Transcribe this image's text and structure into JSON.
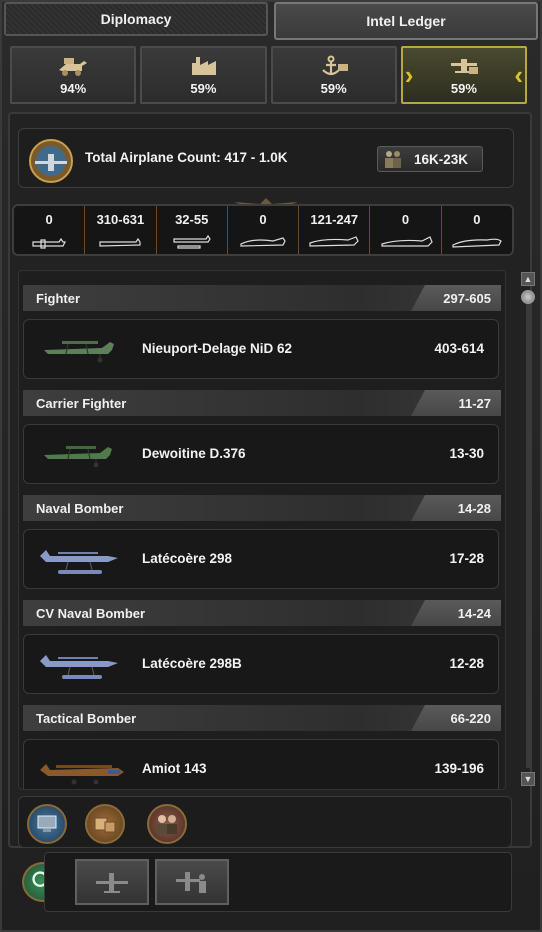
{
  "tabs": [
    {
      "label": "Diplomacy"
    },
    {
      "label": "Intel Ledger"
    }
  ],
  "categories": [
    {
      "icon": "army-icon",
      "value": "94%"
    },
    {
      "icon": "industry-icon",
      "value": "59%"
    },
    {
      "icon": "navy-icon",
      "value": "59%"
    },
    {
      "icon": "airforce-icon",
      "value": "59%"
    }
  ],
  "summary": {
    "total_label": "Total Airplane Count: 417 - 1.0K",
    "manpower": "16K-23K"
  },
  "aircraft_types": [
    {
      "icon": "cas-silhouette-icon",
      "value": "0"
    },
    {
      "icon": "transport-plane-icon",
      "value": "310-631"
    },
    {
      "icon": "naval-bomber-silhouette-icon",
      "value": "32-55"
    },
    {
      "icon": "heavy-fighter-silhouette-icon",
      "value": "0"
    },
    {
      "icon": "tactical-bomber-silhouette-icon",
      "value": "121-247"
    },
    {
      "icon": "strategic-bomber-silhouette-icon",
      "value": "0"
    },
    {
      "icon": "jet-silhouette-icon",
      "value": "0"
    }
  ],
  "sections": [
    {
      "name": "Fighter",
      "value": "297-605",
      "entry": {
        "name": "Nieuport-Delage NiD 62",
        "value": "403-614"
      }
    },
    {
      "name": "Carrier Fighter",
      "value": "11-27",
      "entry": {
        "name": "Dewoitine D.376",
        "value": "13-30"
      }
    },
    {
      "name": "Naval Bomber",
      "value": "14-28",
      "entry": {
        "name": "Latécoère 298",
        "value": "17-28"
      }
    },
    {
      "name": "CV Naval Bomber",
      "value": "14-24",
      "entry": {
        "name": "Latécoère 298B",
        "value": "12-28"
      }
    },
    {
      "name": "Tactical Bomber",
      "value": "66-220",
      "entry": {
        "name": "Amiot 143",
        "value": "139-196"
      }
    }
  ],
  "colors": {
    "accent_gold": "#d9c32c",
    "text": "#f0f0f0",
    "bg": "#1b1b1b"
  }
}
